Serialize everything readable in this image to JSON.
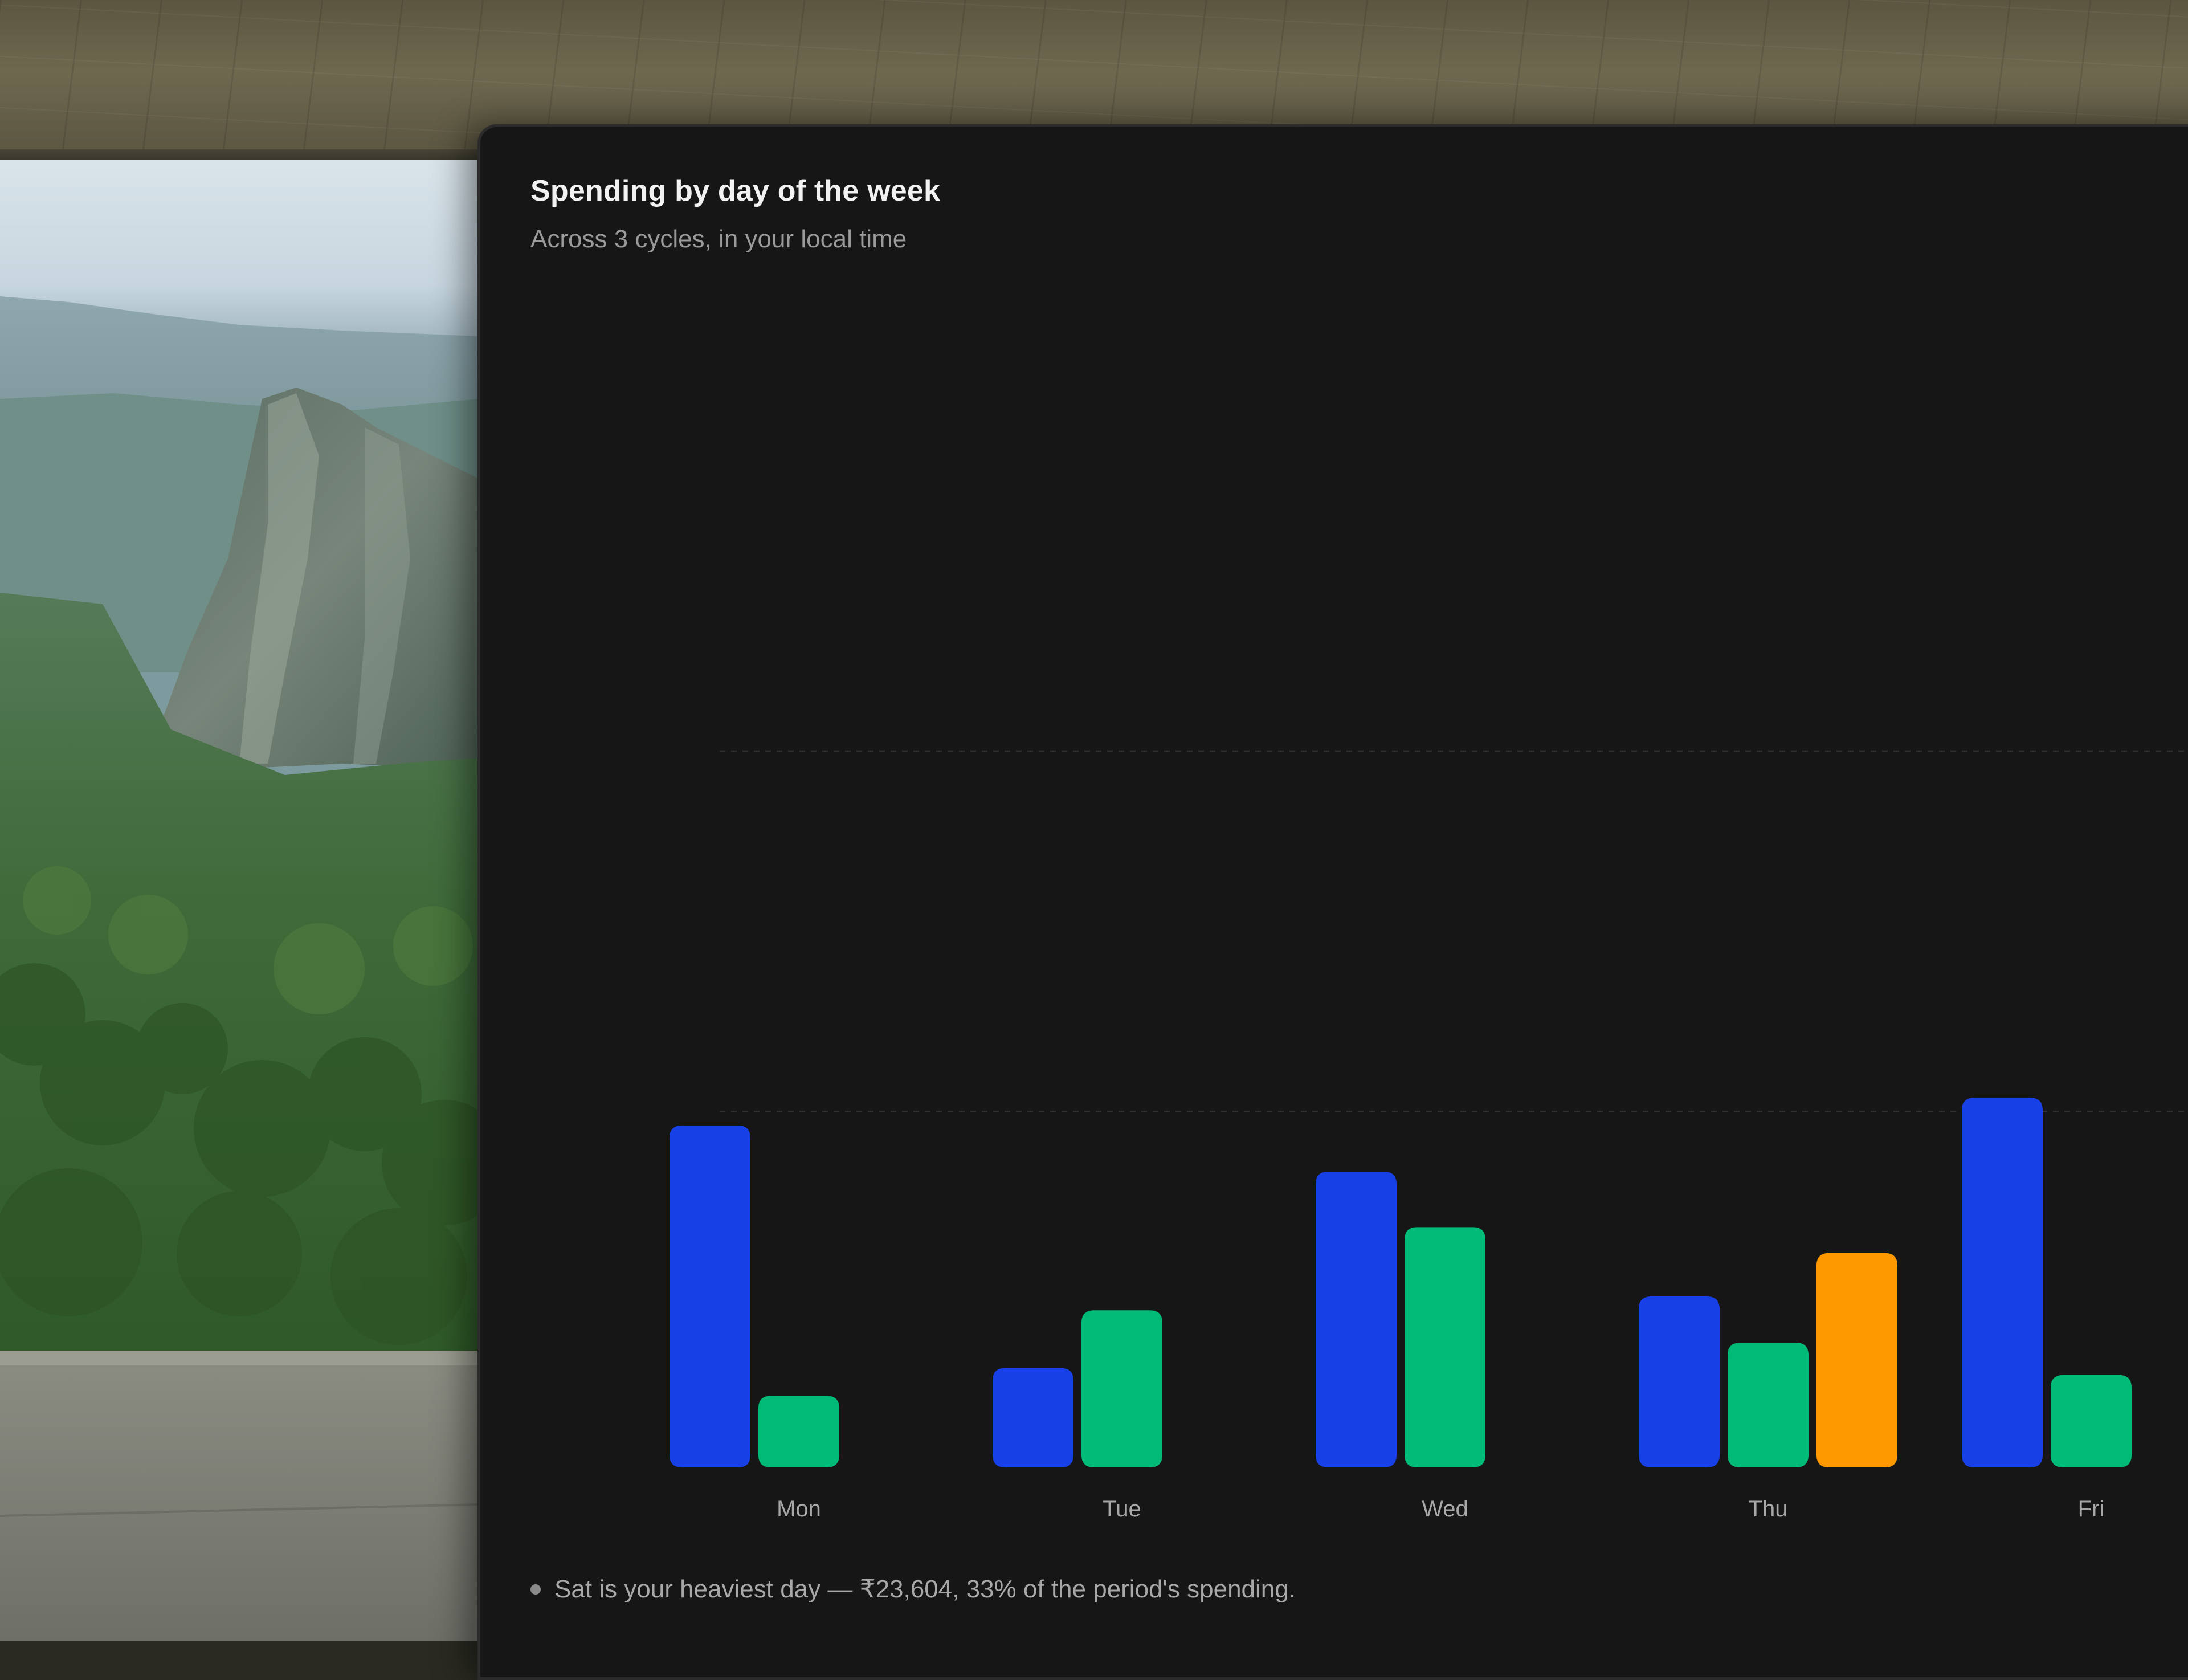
{
  "card": {
    "title": "Spending by day of the week",
    "subtitle": "Across 3 cycles, in your local time",
    "footnote": "Sat is your heaviest day — ₹23,604, 33% of the period's spending."
  },
  "colors": {
    "panel_bg": "#161616",
    "gridline": "#2e2e2e",
    "tick_label": "#a8a8a8"
  },
  "chart_data": {
    "type": "bar",
    "categories": [
      "Mon",
      "Tue",
      "Wed",
      "Thu",
      "Fri"
    ],
    "series": [
      {
        "color": "#1741e6",
        "values": [
          7400,
          2150,
          6400,
          3700,
          8000
        ]
      },
      {
        "color": "#00bb77",
        "values": [
          1550,
          3400,
          5200,
          2700,
          2000
        ]
      },
      {
        "color": "#ff9900",
        "values": [
          null,
          null,
          null,
          4640,
          null
        ]
      }
    ],
    "ylim": [
      0,
      23604
    ],
    "gridlines": [
      7700,
      15500
    ],
    "grid": true,
    "legend": "none"
  }
}
